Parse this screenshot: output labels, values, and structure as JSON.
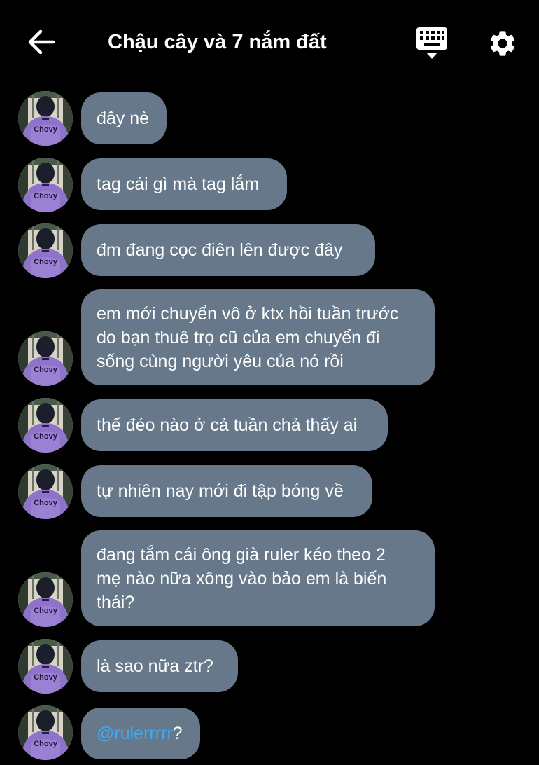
{
  "header": {
    "title": "Chậu cây và 7 nắm đất",
    "back_icon": "arrow-left-icon",
    "keyboard_icon": "keyboard-icon",
    "settings_icon": "gear-icon"
  },
  "avatar": {
    "shirt_text": "Chovy"
  },
  "messages": [
    {
      "text": "đây nè"
    },
    {
      "text": "tag cái gì mà tag lắm"
    },
    {
      "text": "đm đang cọc điên lên được đây"
    },
    {
      "text": "em mới chuyển vô ở ktx hồi tuần trước\ndo bạn thuê trọ cũ của em chuyển đi\nsống cùng người yêu của nó rồi"
    },
    {
      "text": "thế đéo nào ở cả tuần chả thấy ai"
    },
    {
      "text": "tự nhiên nay mới đi tập bóng về"
    },
    {
      "text": "đang tắm cái ông già ruler kéo theo 2\nmẹ nào nữa xông vào bảo em là biến\nthái?"
    },
    {
      "text": "là sao nữa ztr?"
    },
    {
      "mention": "@rulerrrrr",
      "suffix": "?"
    }
  ],
  "colors": {
    "background": "#000000",
    "bubble": "#66788a",
    "mention": "#3fa9f5",
    "text": "#ffffff"
  }
}
